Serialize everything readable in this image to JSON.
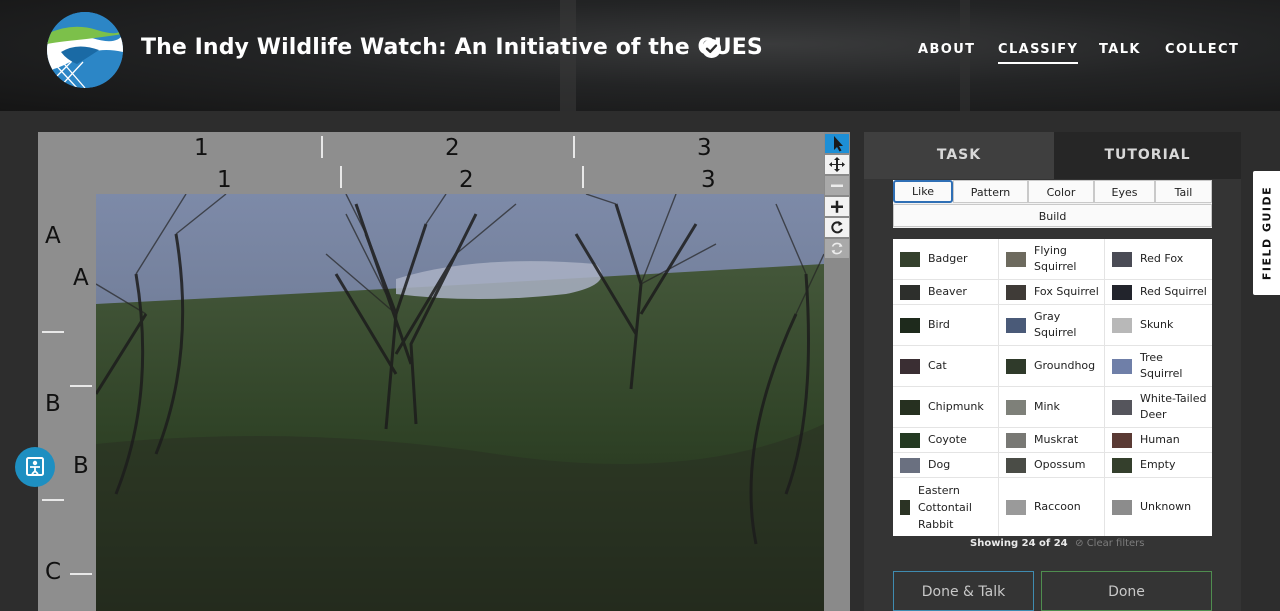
{
  "header": {
    "title": "The Indy Wildlife Watch: An Initiative of the CUES",
    "nav": [
      {
        "label": "ABOUT",
        "active": false
      },
      {
        "label": "CLASSIFY",
        "active": true
      },
      {
        "label": "TALK",
        "active": false
      },
      {
        "label": "COLLECT",
        "active": false
      }
    ]
  },
  "viewer": {
    "col_labels_outer": [
      "1",
      "2",
      "3"
    ],
    "col_labels_inner": [
      "1",
      "2",
      "3"
    ],
    "row_labels_outer": [
      "A",
      "B",
      "C"
    ],
    "row_labels_inner": [
      "A",
      "B"
    ]
  },
  "tools": [
    "pointer-icon",
    "move-icon",
    "zoom-out-icon",
    "zoom-in-icon",
    "rotate-icon",
    "reset-icon"
  ],
  "panel": {
    "tabs": [
      "TASK",
      "TUTORIAL"
    ],
    "filters": [
      "Like",
      "Pattern",
      "Color",
      "Eyes",
      "Tail",
      "Build"
    ],
    "species": [
      [
        "Badger",
        "Flying Squirrel",
        "Red Fox"
      ],
      [
        "Beaver",
        "Fox Squirrel",
        "Red Squirrel"
      ],
      [
        "Bird",
        "Gray Squirrel",
        "Skunk"
      ],
      [
        "Cat",
        "Groundhog",
        "Tree Squirrel"
      ],
      [
        "Chipmunk",
        "Mink",
        "White-Tailed Deer"
      ],
      [
        "Coyote",
        "Muskrat",
        "Human"
      ],
      [
        "Dog",
        "Opossum",
        "Empty"
      ],
      [
        "Eastern Cottontail Rabbit",
        "Raccoon",
        "Unknown"
      ]
    ],
    "showing": "Showing 24 of 24",
    "clear_filters": "Clear filters",
    "done_talk": "Done & Talk",
    "done": "Done"
  },
  "field_guide": "FIELD GUIDE",
  "colors": {
    "accent_blue": "#1d8fd6",
    "done_talk_border": "#3f8bb0",
    "done_border": "#4f8d4f"
  }
}
